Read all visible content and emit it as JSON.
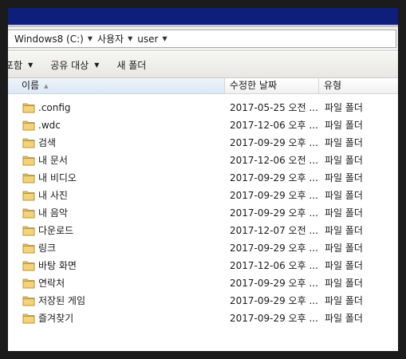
{
  "address": {
    "crumbs": [
      "Windows8 (C:)",
      "사용자",
      "user"
    ]
  },
  "toolbar": {
    "include_label": "포함",
    "share_label": "공유 대상",
    "new_folder_label": "새 폴더"
  },
  "columns": {
    "name": "이름",
    "date": "수정한 날짜",
    "type": "유형"
  },
  "files": [
    {
      "name": ".config",
      "date": "2017-05-25 오전 ...",
      "type": "파일 폴더",
      "icon": "folder-icon"
    },
    {
      "name": ".wdc",
      "date": "2017-12-06 오후 ...",
      "type": "파일 폴더",
      "icon": "folder-icon"
    },
    {
      "name": "검색",
      "date": "2017-09-29 오후 ...",
      "type": "파일 폴더",
      "icon": "searches-folder-icon"
    },
    {
      "name": "내 문서",
      "date": "2017-12-06 오전 ...",
      "type": "파일 폴더",
      "icon": "documents-folder-icon"
    },
    {
      "name": "내 비디오",
      "date": "2017-09-29 오후 ...",
      "type": "파일 폴더",
      "icon": "videos-folder-icon"
    },
    {
      "name": "내 사진",
      "date": "2017-09-29 오후 ...",
      "type": "파일 폴더",
      "icon": "pictures-folder-icon"
    },
    {
      "name": "내 음악",
      "date": "2017-09-29 오후 ...",
      "type": "파일 폴더",
      "icon": "music-folder-icon"
    },
    {
      "name": "다운로드",
      "date": "2017-12-07 오전 ...",
      "type": "파일 폴더",
      "icon": "downloads-folder-icon"
    },
    {
      "name": "링크",
      "date": "2017-09-29 오후 ...",
      "type": "파일 폴더",
      "icon": "links-folder-icon"
    },
    {
      "name": "바탕 화면",
      "date": "2017-12-06 오후 ...",
      "type": "파일 폴더",
      "icon": "desktop-folder-icon"
    },
    {
      "name": "연락처",
      "date": "2017-09-29 오후 ...",
      "type": "파일 폴더",
      "icon": "contacts-folder-icon"
    },
    {
      "name": "저장된 게임",
      "date": "2017-09-29 오후 ...",
      "type": "파일 폴더",
      "icon": "saved-games-folder-icon"
    },
    {
      "name": "즐겨찾기",
      "date": "2017-09-29 오후 ...",
      "type": "파일 폴더",
      "icon": "favorites-folder-icon"
    }
  ],
  "colors": {
    "titlebar": "#0d1f7a",
    "folder": "#e8c060"
  }
}
